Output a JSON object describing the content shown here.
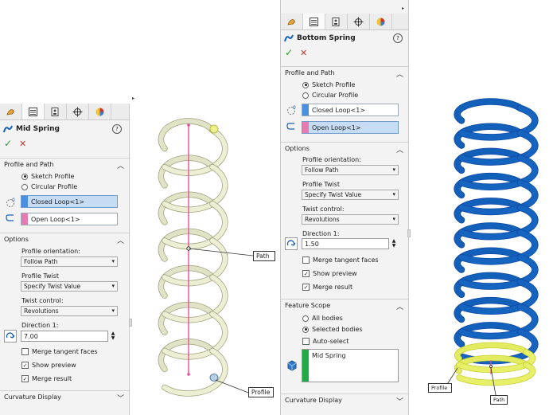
{
  "colors": {
    "spring_a": "#ecefd3",
    "spring_a_stroke": "#9ea07a",
    "spring_b": "#1565c0",
    "spring_b_dark": "#0d47a1",
    "selection_yellow": "#e8f06a",
    "path_pink": "#e2509c",
    "ok_green": "#2d9b2d",
    "cancel_red": "#c0392b"
  },
  "left_panel": {
    "title": "Mid Spring",
    "sections": {
      "profile_path": "Profile and Path",
      "options": "Options",
      "curvature": "Curvature Display"
    },
    "radio_sketch": "Sketch Profile",
    "radio_circular": "Circular Profile",
    "profile_sel": "Closed Loop<1>",
    "path_sel": "Open Loop<1>",
    "orientation_label": "Profile orientation:",
    "orientation_value": "Follow Path",
    "twist_label": "Profile Twist",
    "twist_value": "Specify Twist Value",
    "twist_control_label": "Twist control:",
    "twist_control_value": "Revolutions",
    "direction_label": "Direction 1:",
    "direction_value": "7.00",
    "merge_tangent": "Merge tangent faces",
    "show_preview": "Show preview",
    "merge_result": "Merge result"
  },
  "right_panel": {
    "title": "Bottom Spring",
    "sections": {
      "profile_path": "Profile and Path",
      "options": "Options",
      "feature_scope": "Feature Scope",
      "curvature": "Curvature Display"
    },
    "radio_sketch": "Sketch Profile",
    "radio_circular": "Circular Profile",
    "profile_sel": "Closed Loop<1>",
    "path_sel": "Open Loop<1>",
    "orientation_label": "Profile orientation:",
    "orientation_value": "Follow Path",
    "twist_label": "Profile Twist",
    "twist_value": "Specify Twist Value",
    "twist_control_label": "Twist control:",
    "twist_control_value": "Revolutions",
    "direction_label": "Direction 1:",
    "direction_value": "1.50",
    "merge_tangent": "Merge tangent faces",
    "show_preview": "Show preview",
    "merge_result": "Merge result",
    "all_bodies": "All bodies",
    "selected_bodies": "Selected bodies",
    "auto_select": "Auto-select",
    "body_item": "Mid Spring"
  },
  "callouts": {
    "path": "Path",
    "profile": "Profile",
    "path_b": "Path",
    "profile_b": "Profile"
  },
  "helix_a": {
    "turns": 7
  },
  "helix_b": {
    "turns": 10
  }
}
